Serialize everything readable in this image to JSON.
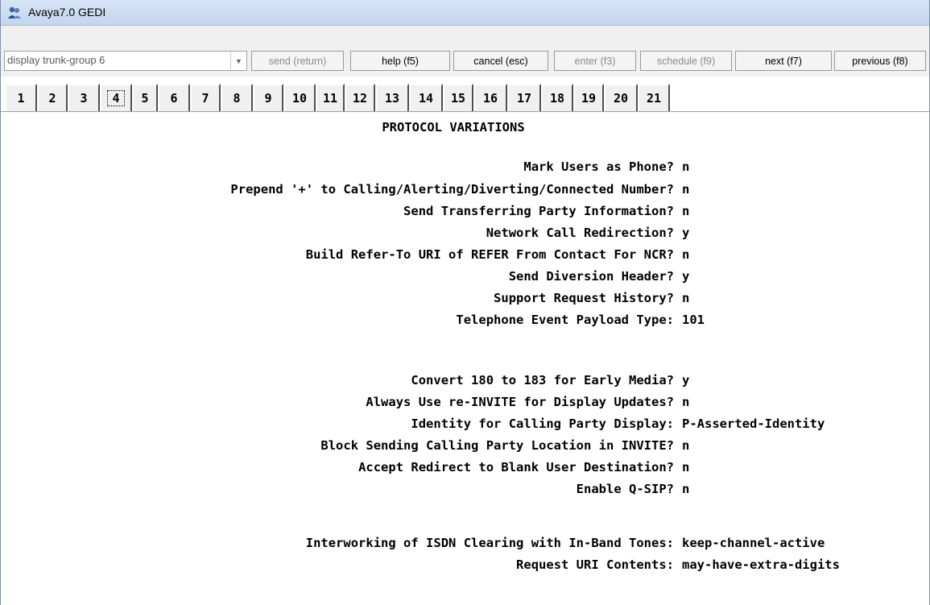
{
  "window": {
    "title": "Avaya7.0 GEDI"
  },
  "toolbar": {
    "command": "display trunk-group 6",
    "buttons": [
      {
        "label": "send (return)",
        "enabled": false
      },
      {
        "label": "help (f5)",
        "enabled": true
      },
      {
        "label": "cancel (esc)",
        "enabled": true
      },
      {
        "label": "enter (f3)",
        "enabled": false
      },
      {
        "label": "schedule (f9)",
        "enabled": false
      },
      {
        "label": "next (f7)",
        "enabled": true
      },
      {
        "label": "previous (f8)",
        "enabled": true
      }
    ]
  },
  "tabs": [
    "1",
    "2",
    "3",
    "4",
    "5",
    "6",
    "7",
    "8",
    "9",
    "10",
    "11",
    "12",
    "13",
    "14",
    "15",
    "16",
    "17",
    "18",
    "19",
    "20",
    "21"
  ],
  "active_tab": "4",
  "screen": {
    "title": "PROTOCOL VARIATIONS",
    "fields": [
      {
        "label": "Mark Users as Phone?",
        "value": "n"
      },
      {
        "label": "Prepend '+' to Calling/Alerting/Diverting/Connected Number?",
        "value": "n"
      },
      {
        "label": "Send Transferring Party Information?",
        "value": "n"
      },
      {
        "label": "Network Call Redirection?",
        "value": "y"
      },
      {
        "label": "Build Refer-To URI of REFER From Contact For NCR?",
        "value": "n"
      },
      {
        "label": "Send Diversion Header?",
        "value": "y"
      },
      {
        "label": "Support Request History?",
        "value": "n"
      },
      {
        "label": "Telephone Event Payload Type:",
        "value": "101"
      },
      {
        "label": "Convert 180 to 183 for Early Media?",
        "value": "y"
      },
      {
        "label": "Always Use re-INVITE for Display Updates?",
        "value": "n"
      },
      {
        "label": "Identity for Calling Party Display:",
        "value": "P-Asserted-Identity"
      },
      {
        "label": "Block Sending Calling Party Location in INVITE?",
        "value": "n"
      },
      {
        "label": "Accept Redirect to Blank User Destination?",
        "value": "n"
      },
      {
        "label": "Enable Q-SIP?",
        "value": "n"
      },
      {
        "label": "Interworking of ISDN Clearing with In-Band Tones:",
        "value": "keep-channel-active"
      },
      {
        "label": "Request URI Contents:",
        "value": "may-have-extra-digits"
      }
    ]
  },
  "colors": {
    "titlebar": "#c9daf0",
    "toolbar": "#f0f0f0",
    "screen": "#ffffff",
    "text": "#000000"
  }
}
